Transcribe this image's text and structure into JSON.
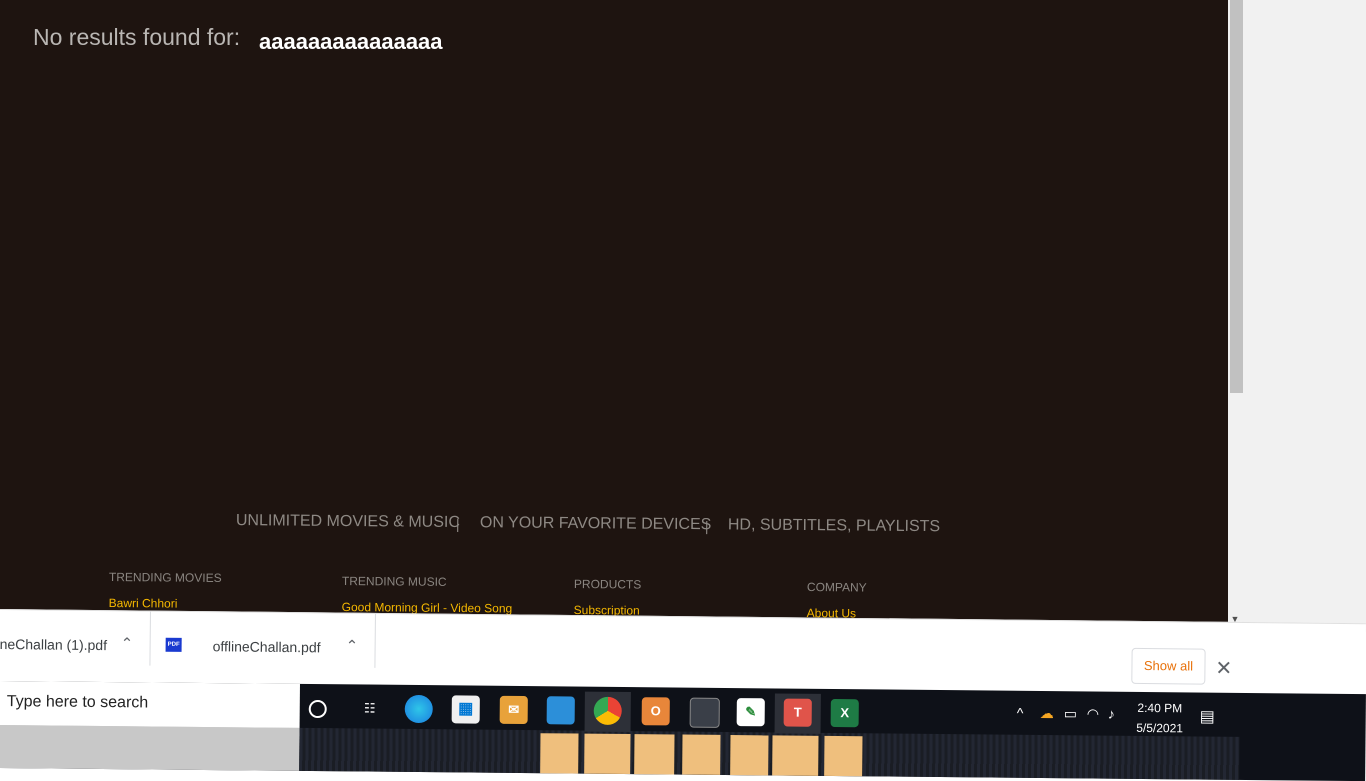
{
  "search_result": {
    "label": "No results found for:",
    "query": "aaaaaaaaaaaaaaa"
  },
  "features": [
    "UNLIMITED MOVIES & MUSIC",
    "ON YOUR FAVORITE DEVICES",
    "HD, SUBTITLES, PLAYLISTS"
  ],
  "feature_separator": "|",
  "footer": {
    "columns": [
      {
        "heading": "TRENDING MOVIES",
        "link": "Bawri Chhori"
      },
      {
        "heading": "TRENDING MUSIC",
        "link": "Good Morning Girl - Video Song"
      },
      {
        "heading": "PRODUCTS",
        "link": "Subscription"
      },
      {
        "heading": "COMPANY",
        "link": "About Us"
      }
    ]
  },
  "downloads": {
    "items": [
      {
        "name": "neChallan (1).pdf"
      },
      {
        "name": "offlineChallan.pdf",
        "icon_label": "PDF"
      }
    ],
    "show_all": "Show all",
    "close": "✕"
  },
  "taskbar": {
    "search_placeholder": "Type here to search",
    "apps": [
      "cortana-icon",
      "task-view-icon",
      "edge-icon",
      "store-icon",
      "mail-icon",
      "file-explorer-icon",
      "chrome-icon",
      "outlook-icon",
      "terminal-icon",
      "editor-icon",
      "teams-icon",
      "excel-icon"
    ],
    "time": "2:40 PM",
    "date": "5/5/2021"
  },
  "colors": {
    "page_bg": "#1e1410",
    "accent_link": "#f5b800",
    "show_all": "#e8710a"
  }
}
